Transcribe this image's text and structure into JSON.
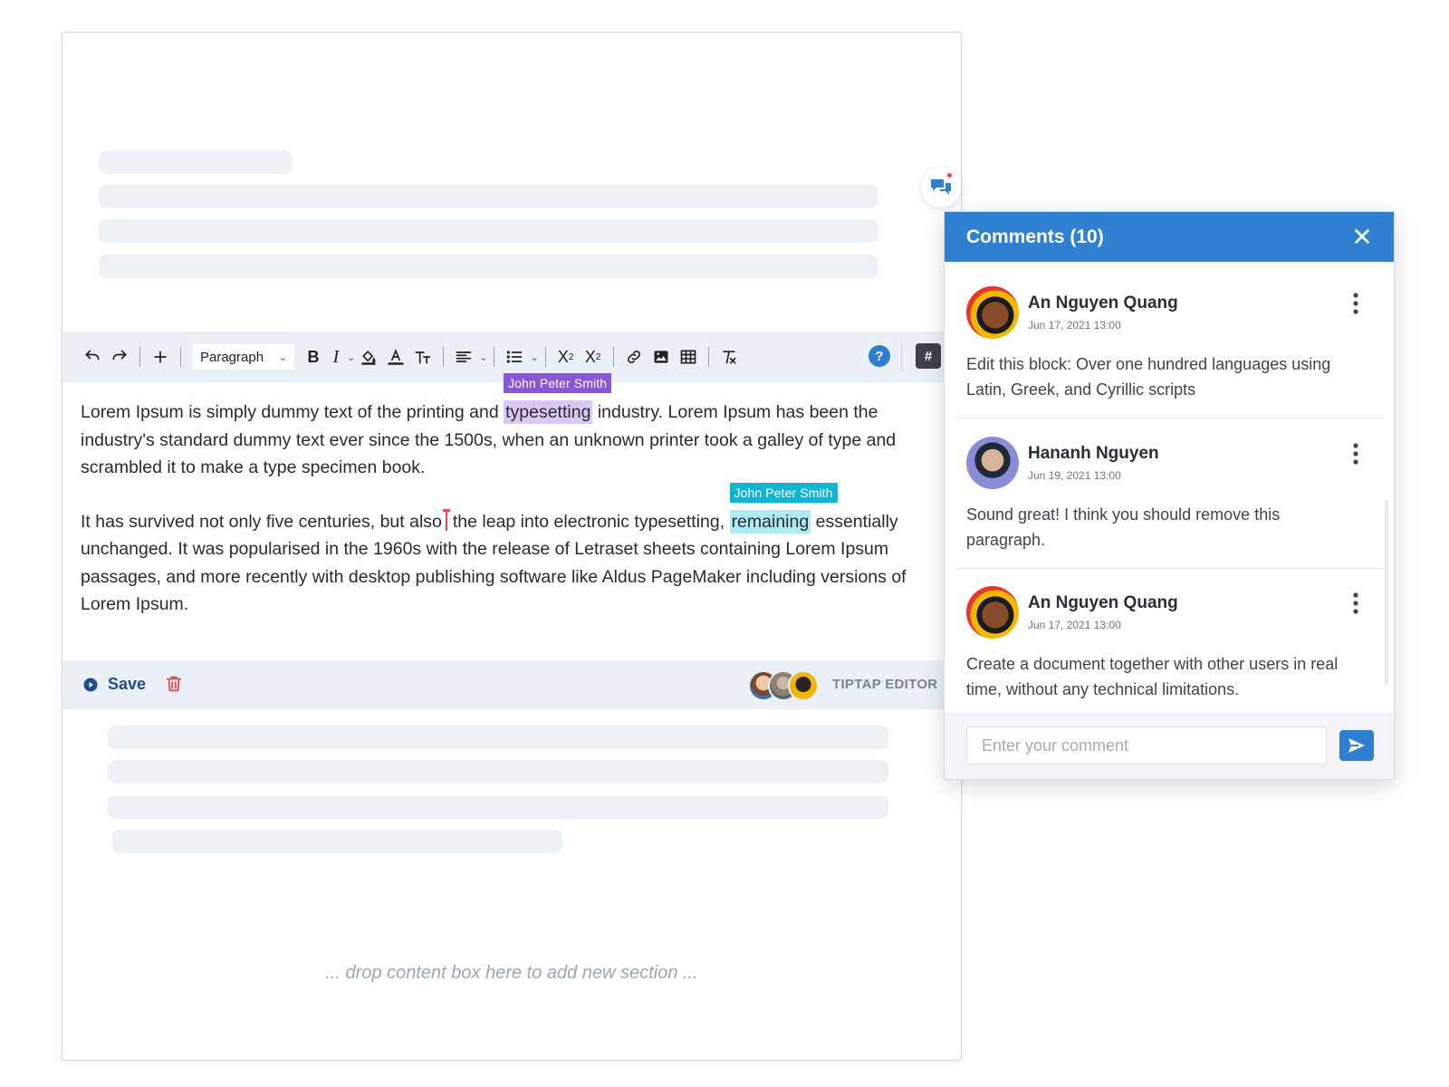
{
  "toolbar": {
    "paragraph_select": "Paragraph",
    "help_label": "?",
    "hash_label": "#"
  },
  "content": {
    "p1_before": "Lorem Ipsum is simply dummy text of the printing and ",
    "p1_highlight": "typesetting",
    "p1_after": " industry. Lorem Ipsum has been the industry's standard dummy text ever since the 1500s, when an unknown printer took a galley of type and scrambled it to make a type specimen book.",
    "p2_before": "It has survived not only five centuries, but also",
    "p2_middle": "the leap into electronic typesetting, ",
    "p2_highlight": "remaining",
    "p2_after": " essentially unchanged. It was popularised in the 1960s with the release of Letraset sheets containing Lorem Ipsum passages, and more recently with desktop publishing software like Aldus PageMaker including versions of Lorem Ipsum.",
    "collaborator_1": "John Peter Smith",
    "collaborator_2": "John Peter Smith"
  },
  "savebar": {
    "save_label": "Save",
    "editor_label": "TIPTAP EDITOR"
  },
  "drop_text": "... drop content box here to add new section ...",
  "comments_panel": {
    "title": "Comments (10)",
    "comments": [
      {
        "author": "An Nguyen Quang",
        "date": "Jun 17, 2021 13:00",
        "text": "Edit this block: Over one hundred languages using Latin, Greek, and Cyrillic scripts"
      },
      {
        "author": "Hananh Nguyen",
        "date": "Jun 19, 2021 13:00",
        "text": "Sound great! I think you should remove this paragraph."
      },
      {
        "author": "An Nguyen Quang",
        "date": "Jun 17, 2021 13:00",
        "text": "Create a document together with other users in real time, without any technical limitations."
      }
    ],
    "input_placeholder": "Enter your comment"
  },
  "colors": {
    "accent": "#2f80d1",
    "highlight_purple": "#d9c7f5",
    "highlight_cyan": "#aeeaf3",
    "label_purple": "#8b56d6",
    "label_cyan": "#10b6d1"
  }
}
